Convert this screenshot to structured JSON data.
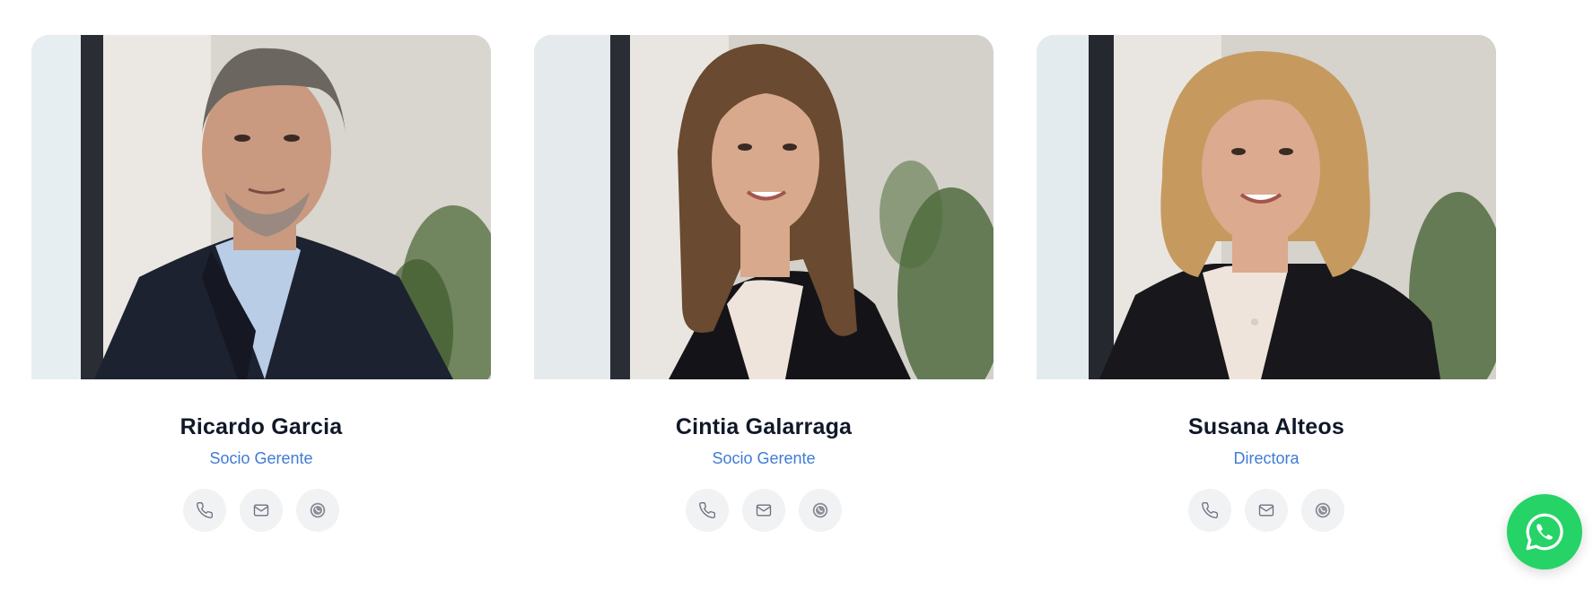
{
  "team": {
    "members": [
      {
        "name": "Ricardo Garcia",
        "role": "Socio Gerente",
        "photo": {
          "hair": "#6b6660",
          "skin": "#c99a80",
          "shirt": "#b9cde6",
          "jacket": "#1d2230"
        },
        "actions": [
          "phone-icon",
          "mail-icon",
          "whatsapp-icon"
        ]
      },
      {
        "name": "Cintia Galarraga",
        "role": "Socio Gerente",
        "photo": {
          "hair": "#6a4a30",
          "skin": "#d8a98c",
          "shirt": "#efe4dc",
          "jacket": "#141418"
        },
        "actions": [
          "phone-icon",
          "mail-icon",
          "whatsapp-icon"
        ]
      },
      {
        "name": "Susana Alteos",
        "role": "Directora",
        "photo": {
          "hair": "#c69a5e",
          "skin": "#dcaa8e",
          "shirt": "#efe4dc",
          "jacket": "#17171c"
        },
        "actions": [
          "phone-icon",
          "mail-icon",
          "whatsapp-icon"
        ]
      }
    ]
  },
  "colors": {
    "name_text": "#101828",
    "role_text": "#3f7bd6",
    "action_bg": "#f1f2f4",
    "icon_stroke": "#6b7280",
    "whatsapp_green": "#25d366"
  },
  "floating_button": {
    "icon": "whatsapp-icon"
  }
}
